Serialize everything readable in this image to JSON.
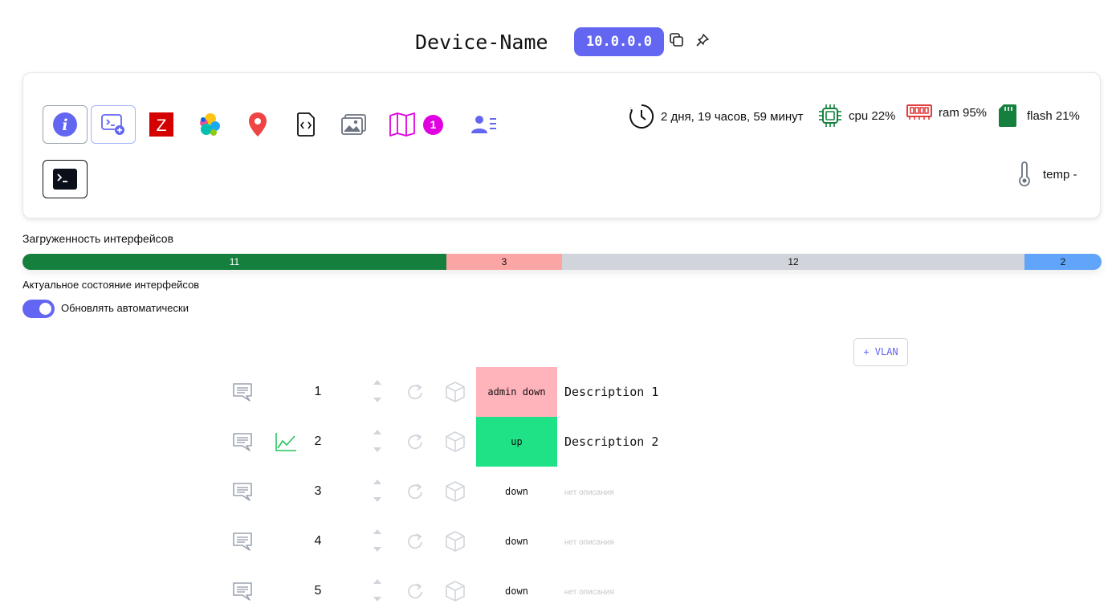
{
  "device": {
    "name": "Device-Name",
    "ip": "10.0.0.0"
  },
  "toolbar": {
    "icons": [
      "info-icon",
      "console-add-icon",
      "zabbix-icon",
      "elastic-icon",
      "location-icon",
      "code-file-icon",
      "images-icon",
      "map-icon",
      "users-list-icon",
      "terminal-icon"
    ],
    "map_badge": "1"
  },
  "stats": {
    "uptime": "2 дня, 19 часов, 59 минут",
    "cpu": "cpu 22%",
    "ram": "ram 95%",
    "flash": "flash 21%",
    "temp": "temp -"
  },
  "load": {
    "title": "Загруженность интерфейсов",
    "segments": [
      {
        "value": "11",
        "color": "#15803d"
      },
      {
        "value": "3",
        "color": "#fca5a5"
      },
      {
        "value": "12",
        "color": "#d1d5db"
      },
      {
        "value": "2",
        "color": "#60a5fa"
      }
    ]
  },
  "state": {
    "title": "Актуальное состояние интерфейсов",
    "auto_update_label": "Обновлять автоматически",
    "auto_update": true
  },
  "vlan_button": "+ VLAN",
  "interfaces": [
    {
      "num": "1",
      "status": "admin down",
      "status_color": "#ffb3ba",
      "description": "Description 1",
      "has_graph": false
    },
    {
      "num": "2",
      "status": "up",
      "status_color": "#1fe287",
      "description": "Description 2",
      "has_graph": true
    },
    {
      "num": "3",
      "status": "down",
      "status_color": "",
      "description": "нет описания",
      "has_graph": false
    },
    {
      "num": "4",
      "status": "down",
      "status_color": "",
      "description": "нет описания",
      "has_graph": false
    },
    {
      "num": "5",
      "status": "down",
      "status_color": "",
      "description": "нет описания",
      "has_graph": false
    }
  ]
}
